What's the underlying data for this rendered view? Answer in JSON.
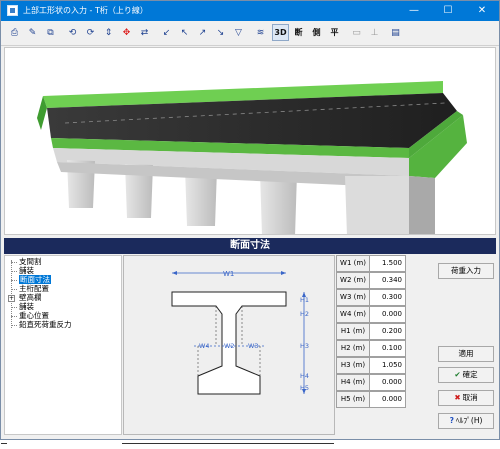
{
  "window": {
    "title": "上部工形状の入力 - T桁（上り線）",
    "minimize": "—",
    "maximize": "☐",
    "close": "✕"
  },
  "toolbar": {
    "view_3d_label": "3D",
    "section_label": "断",
    "side_label": "側",
    "plan_label": "平"
  },
  "section_header": "断面寸法",
  "tree": {
    "items": [
      {
        "label": "支間割"
      },
      {
        "label": "舗装"
      },
      {
        "label": "断面寸法",
        "selected": true
      },
      {
        "label": "主桁配置"
      },
      {
        "label": "壁高欄",
        "expandable": true
      },
      {
        "label": "舗装"
      },
      {
        "label": "重心位置"
      },
      {
        "label": "鉛直死荷重反力"
      }
    ]
  },
  "diagram": {
    "labels": {
      "w1": "W1",
      "w2": "W2",
      "w3": "W3",
      "w4": "W4",
      "h1": "H1",
      "h2": "H2",
      "h3": "H3",
      "h4": "H4",
      "h5": "H5"
    }
  },
  "params": [
    {
      "label": "W1 (m)",
      "value": "1.500"
    },
    {
      "label": "W2 (m)",
      "value": "0.340"
    },
    {
      "label": "W3 (m)",
      "value": "0.300"
    },
    {
      "label": "W4 (m)",
      "value": "0.000"
    },
    {
      "label": "H1 (m)",
      "value": "0.200"
    },
    {
      "label": "H2 (m)",
      "value": "0.100"
    },
    {
      "label": "H3 (m)",
      "value": "1.050"
    },
    {
      "label": "H4 (m)",
      "value": "0.000"
    },
    {
      "label": "H5 (m)",
      "value": "0.000"
    }
  ],
  "buttons": {
    "load_input": "荷重入力",
    "apply": "適用",
    "confirm": "確定",
    "cancel": "取消",
    "help": "ﾍﾙﾌﾟ(H)"
  },
  "colors": {
    "titlebar": "#0078d7",
    "section_header": "#1b2a5c",
    "selection": "#0078d7",
    "parapet_green": "#4caf3c",
    "deck_asphalt": "#2b2b2b"
  }
}
